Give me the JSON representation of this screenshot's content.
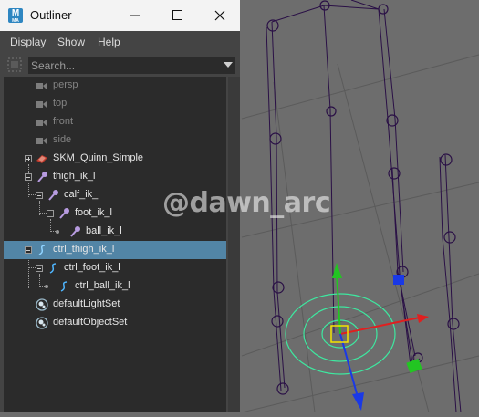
{
  "window": {
    "title": "Outliner",
    "app_icon_letter": "M",
    "app_icon_sub": "MA"
  },
  "menu": [
    "Display",
    "Show",
    "Help"
  ],
  "search": {
    "placeholder": "Search..."
  },
  "items": [
    {
      "label": "persp",
      "icon": "camera-icon",
      "dim": true
    },
    {
      "label": "top",
      "icon": "camera-icon",
      "dim": true
    },
    {
      "label": "front",
      "icon": "camera-icon",
      "dim": true
    },
    {
      "label": "side",
      "icon": "camera-icon",
      "dim": true
    },
    {
      "label": "SKM_Quinn_Simple",
      "icon": "mesh-icon",
      "expander": "plus"
    },
    {
      "label": "thigh_ik_l",
      "icon": "joint-icon",
      "expander": "minus"
    },
    {
      "label": "calf_ik_l",
      "icon": "joint-icon",
      "expander": "minus"
    },
    {
      "label": "foot_ik_l",
      "icon": "joint-icon",
      "expander": "minus"
    },
    {
      "label": "ball_ik_l",
      "icon": "joint-icon"
    },
    {
      "label": "ctrl_thigh_ik_l",
      "icon": "curve-icon",
      "expander": "minus",
      "selected": true
    },
    {
      "label": "ctrl_foot_ik_l",
      "icon": "curve-icon",
      "expander": "minus"
    },
    {
      "label": "ctrl_ball_ik_l",
      "icon": "curve-icon"
    },
    {
      "label": "defaultLightSet",
      "icon": "set-icon"
    },
    {
      "label": "defaultObjectSet",
      "icon": "set-icon"
    }
  ],
  "watermark": "@dawn_arc",
  "colors": {
    "joint": "#2a1046",
    "selection": "#5285a6",
    "grid": "#595959",
    "ring": "#3ee8a0",
    "x_axis": "#e01f1f",
    "y_axis": "#22c522",
    "z_axis": "#1a39e6"
  }
}
